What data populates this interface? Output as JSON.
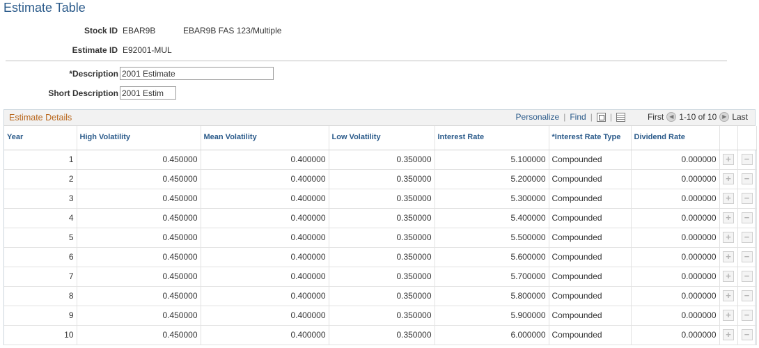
{
  "page": {
    "title": "Estimate Table"
  },
  "stock": {
    "label": "Stock ID",
    "id": "EBAR9B",
    "description": "EBAR9B FAS 123/Multiple"
  },
  "estimate": {
    "label": "Estimate ID",
    "id": "E92001-MUL"
  },
  "description_field": {
    "label": "*Description",
    "value": "2001 Estimate"
  },
  "short_description_field": {
    "label": "Short Description",
    "value": "2001 Estim"
  },
  "grid": {
    "title": "Estimate Details",
    "personalize": "Personalize",
    "separator": "|",
    "find": "Find",
    "first": "First",
    "range": "1-10 of 10",
    "last": "Last",
    "columns": {
      "year": "Year",
      "high": "High Volatility",
      "mean": "Mean Volatility",
      "low": "Low Volatility",
      "interest": "Interest Rate",
      "type": "*Interest Rate Type",
      "dividend": "Dividend Rate"
    },
    "rows": [
      {
        "year": "1",
        "high": "0.450000",
        "mean": "0.400000",
        "low": "0.350000",
        "interest": "5.100000",
        "type": "Compounded",
        "dividend": "0.000000"
      },
      {
        "year": "2",
        "high": "0.450000",
        "mean": "0.400000",
        "low": "0.350000",
        "interest": "5.200000",
        "type": "Compounded",
        "dividend": "0.000000"
      },
      {
        "year": "3",
        "high": "0.450000",
        "mean": "0.400000",
        "low": "0.350000",
        "interest": "5.300000",
        "type": "Compounded",
        "dividend": "0.000000"
      },
      {
        "year": "4",
        "high": "0.450000",
        "mean": "0.400000",
        "low": "0.350000",
        "interest": "5.400000",
        "type": "Compounded",
        "dividend": "0.000000"
      },
      {
        "year": "5",
        "high": "0.450000",
        "mean": "0.400000",
        "low": "0.350000",
        "interest": "5.500000",
        "type": "Compounded",
        "dividend": "0.000000"
      },
      {
        "year": "6",
        "high": "0.450000",
        "mean": "0.400000",
        "low": "0.350000",
        "interest": "5.600000",
        "type": "Compounded",
        "dividend": "0.000000"
      },
      {
        "year": "7",
        "high": "0.450000",
        "mean": "0.400000",
        "low": "0.350000",
        "interest": "5.700000",
        "type": "Compounded",
        "dividend": "0.000000"
      },
      {
        "year": "8",
        "high": "0.450000",
        "mean": "0.400000",
        "low": "0.350000",
        "interest": "5.800000",
        "type": "Compounded",
        "dividend": "0.000000"
      },
      {
        "year": "9",
        "high": "0.450000",
        "mean": "0.400000",
        "low": "0.350000",
        "interest": "5.900000",
        "type": "Compounded",
        "dividend": "0.000000"
      },
      {
        "year": "10",
        "high": "0.450000",
        "mean": "0.400000",
        "low": "0.350000",
        "interest": "6.000000",
        "type": "Compounded",
        "dividend": "0.000000"
      }
    ],
    "add_row_symbol": "+",
    "delete_row_symbol": "−"
  }
}
